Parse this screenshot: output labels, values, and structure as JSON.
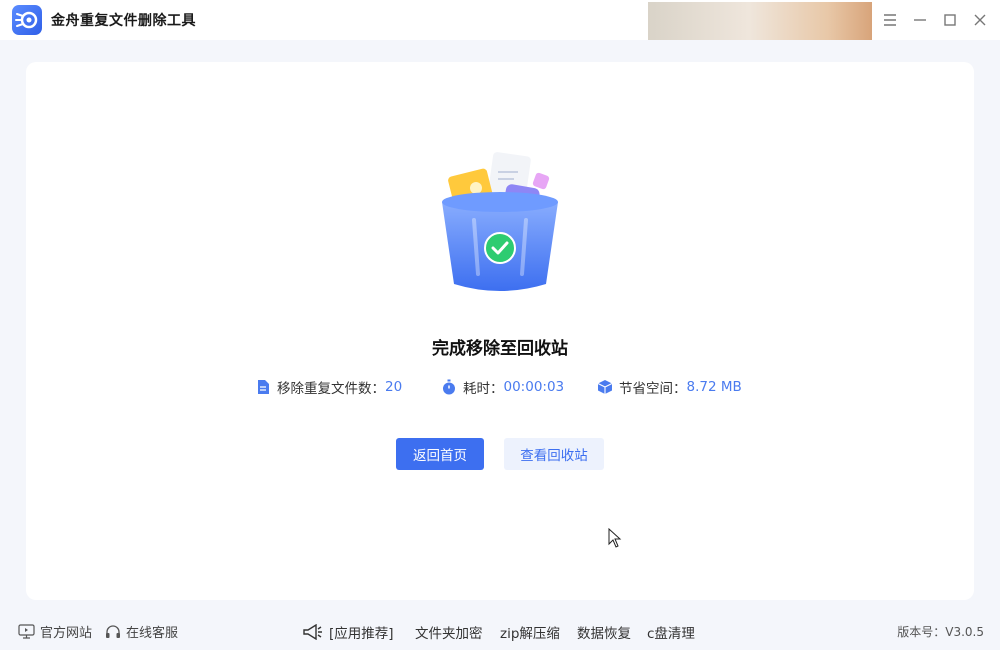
{
  "titlebar": {
    "title": "金舟重复文件删除工具"
  },
  "result": {
    "title": "完成移除至回收站",
    "stats": [
      {
        "icon": "file-icon",
        "label": "移除重复文件数：",
        "value": "20"
      },
      {
        "icon": "stopwatch-icon",
        "label": "耗时：",
        "value": "00:00:03"
      },
      {
        "icon": "cube-icon",
        "label": "节省空间：",
        "value": "8.72 MB"
      }
    ],
    "buttons": {
      "home": "返回首页",
      "recycle_bin": "查看回收站"
    }
  },
  "footer": {
    "website": "官方网站",
    "support": "在线客服",
    "recommend": "[应用推荐]",
    "links": [
      "文件夹加密",
      "zip解压缩",
      "数据恢复",
      "c盘清理"
    ],
    "version": "版本号：V3.0.5"
  },
  "colors": {
    "accent": "#3d6ff0",
    "value_text": "#4a7bef",
    "success": "#2ecc71"
  }
}
